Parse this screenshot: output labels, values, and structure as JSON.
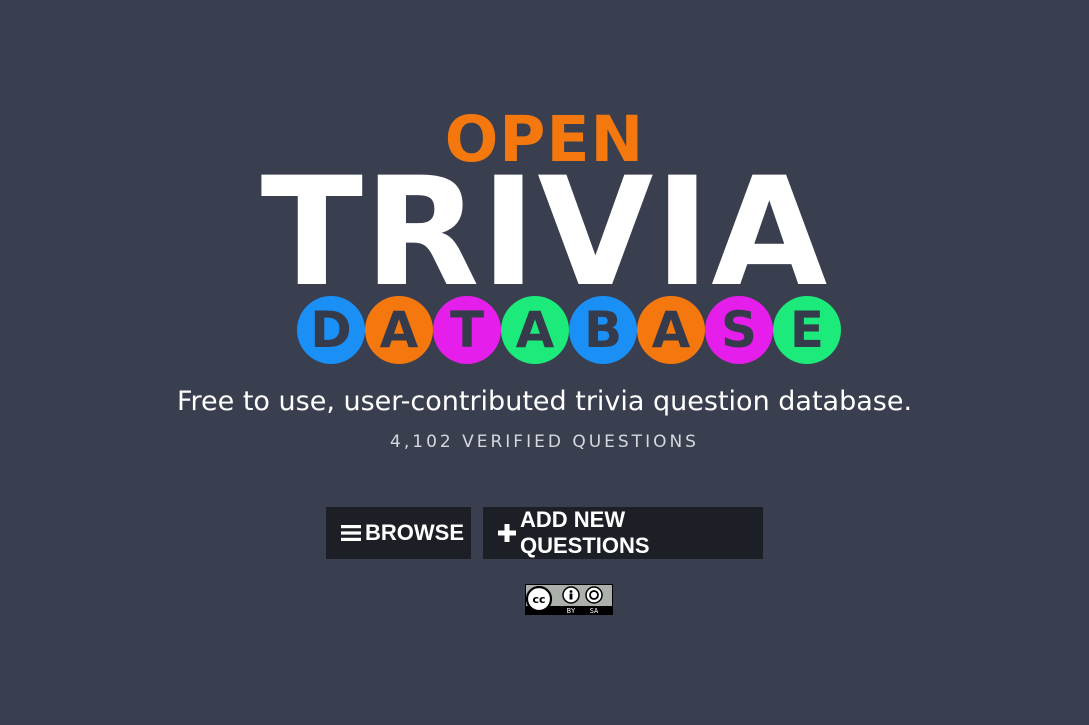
{
  "logo": {
    "open": "OPEN",
    "trivia": "TRIVIA",
    "database_letters": [
      {
        "letter": "D",
        "color": "#1a8ff5"
      },
      {
        "letter": "A",
        "color": "#f5780f"
      },
      {
        "letter": "T",
        "color": "#e61eec"
      },
      {
        "letter": "A",
        "color": "#1cea7a"
      },
      {
        "letter": "B",
        "color": "#1a8ff5"
      },
      {
        "letter": "A",
        "color": "#f5780f"
      },
      {
        "letter": "S",
        "color": "#e61eec"
      },
      {
        "letter": "E",
        "color": "#1cea7a"
      }
    ]
  },
  "tagline": "Free to use, user-contributed trivia question database.",
  "count": "4,102 VERIFIED QUESTIONS",
  "buttons": {
    "browse": {
      "label": "BROWSE",
      "icon": "bars-icon"
    },
    "add": {
      "label": "ADD NEW QUESTIONS",
      "icon": "plus-icon"
    }
  },
  "license": {
    "icon": "cc-by-sa-icon",
    "by": "BY",
    "sa": "SA"
  },
  "colors": {
    "background": "#3a3f4f",
    "orange": "#f5780f",
    "blue": "#1a8ff5",
    "magenta": "#e61eec",
    "green": "#1cea7a",
    "button_bg": "#1c1f26"
  }
}
